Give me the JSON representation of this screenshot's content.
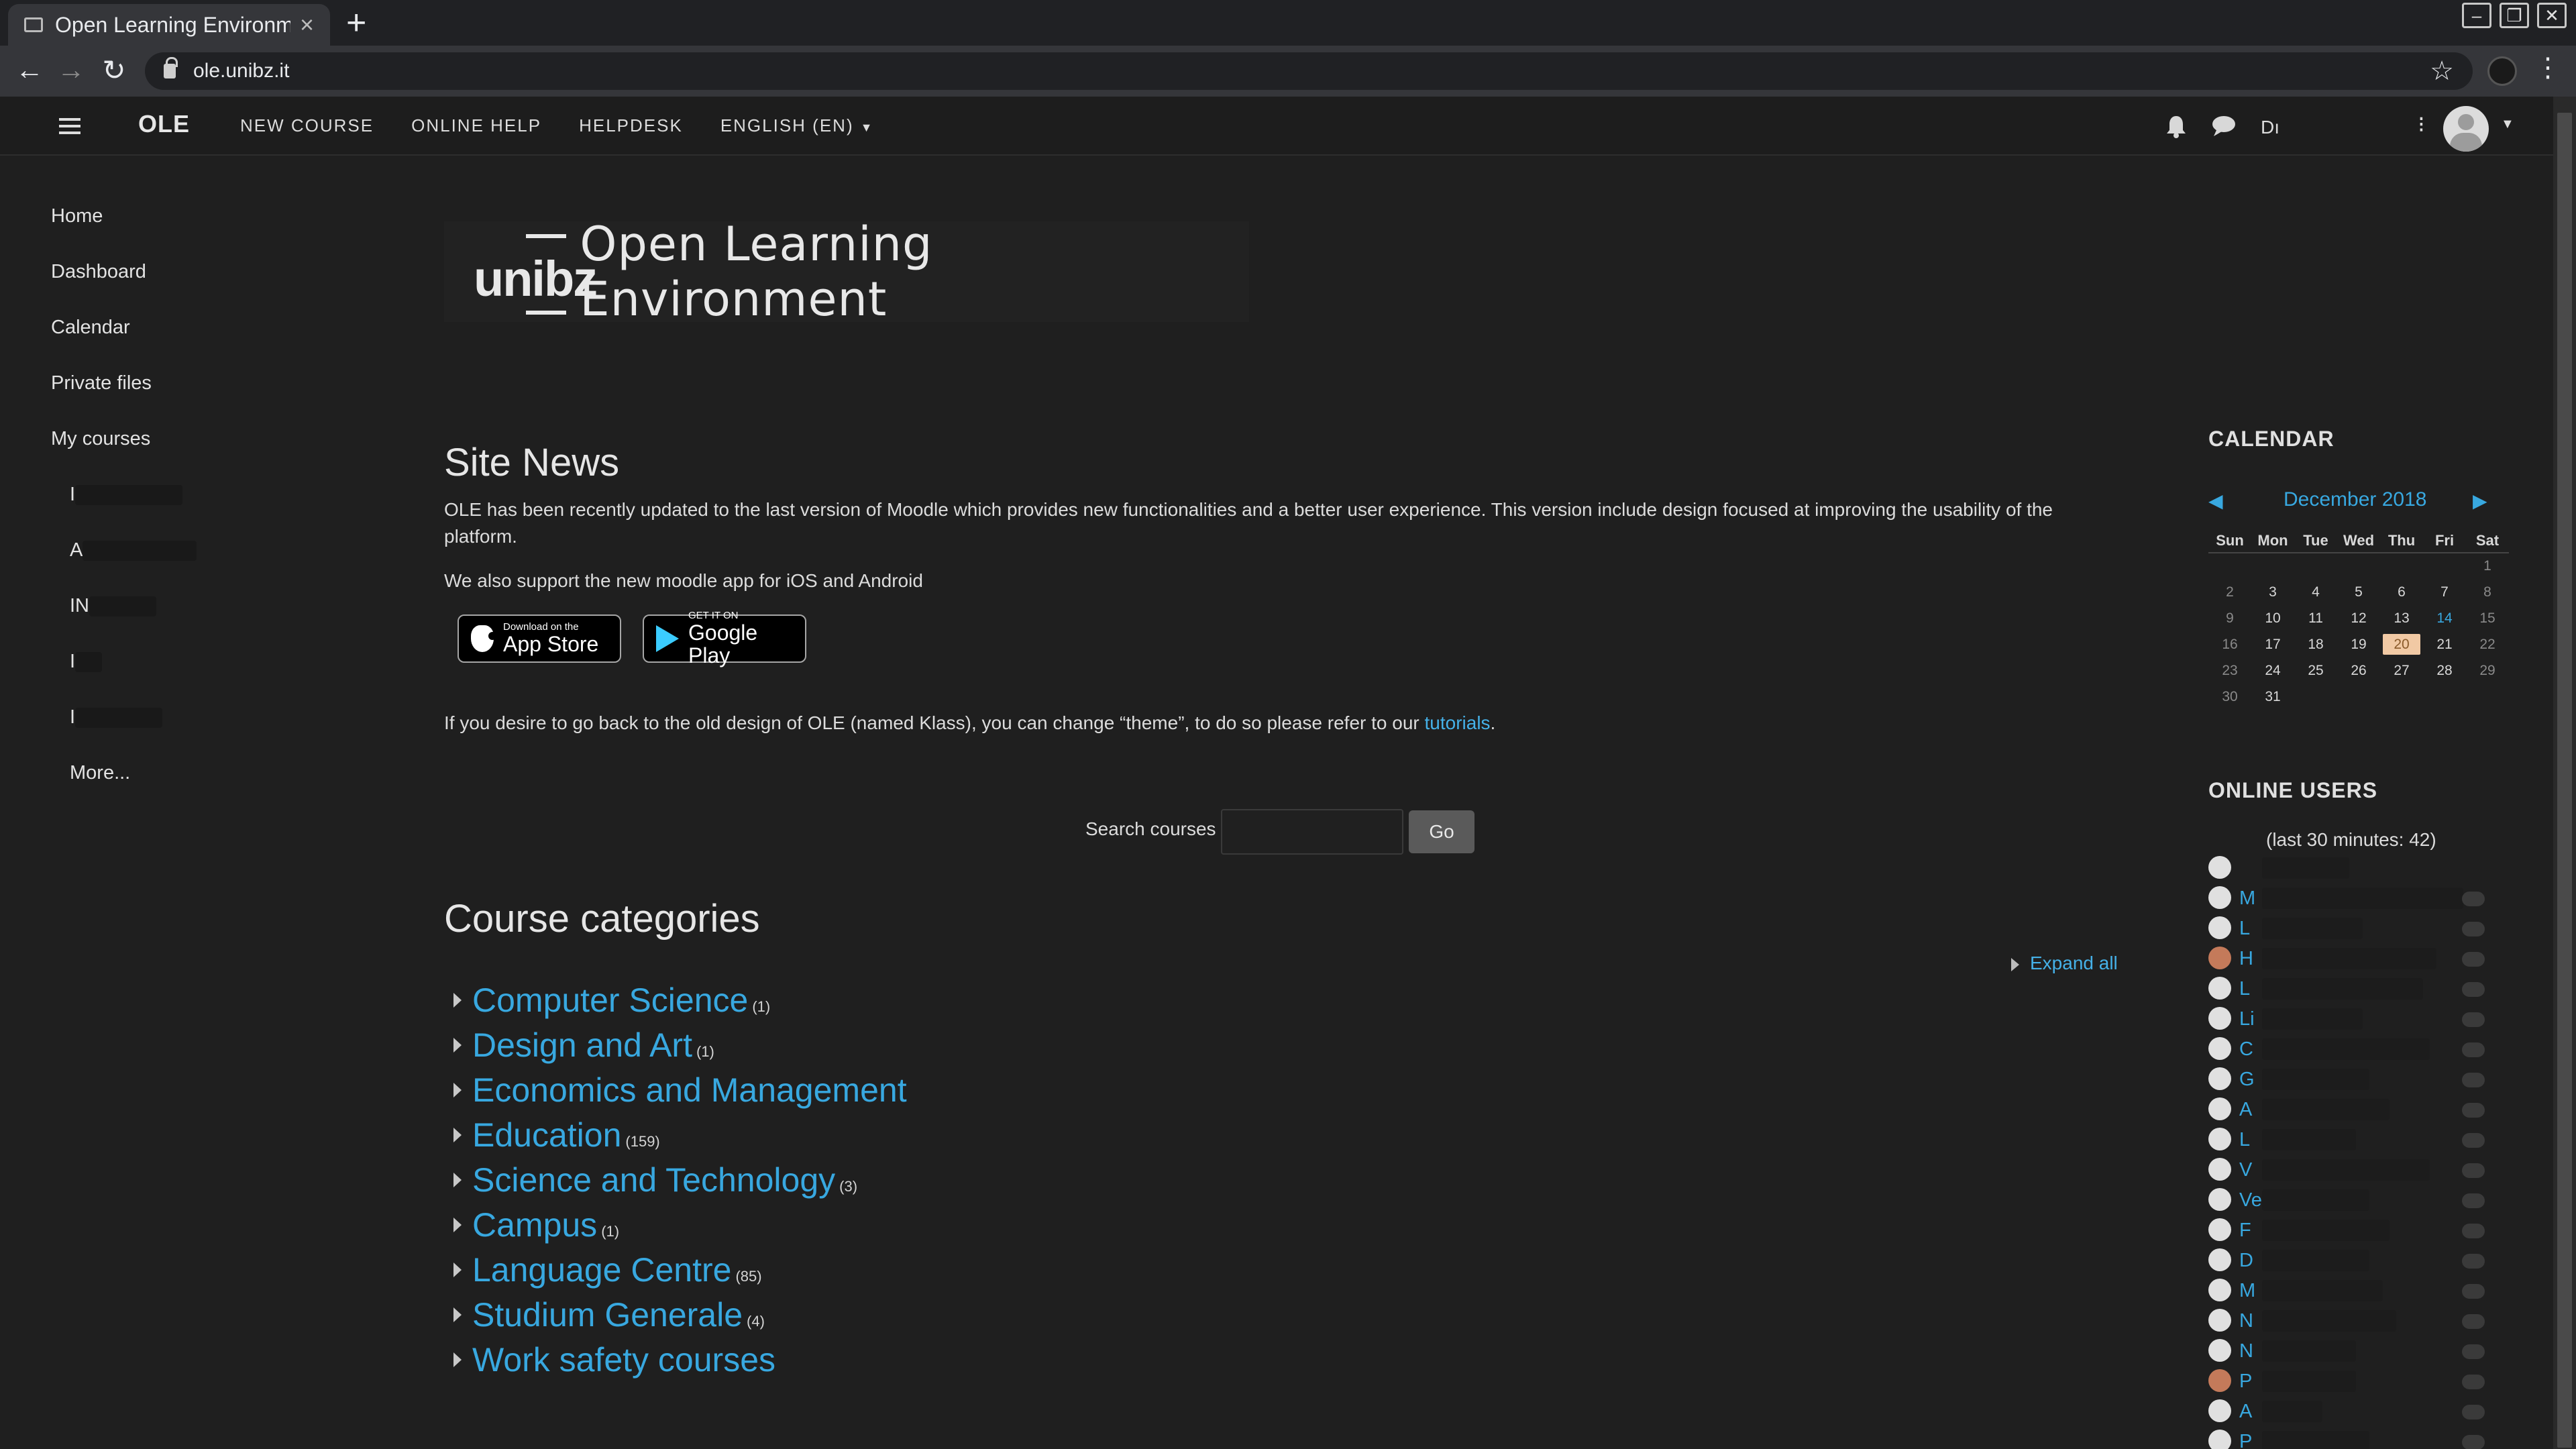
{
  "browser": {
    "tab_title": "Open Learning Environme",
    "url": "ole.unibz.it"
  },
  "navbar": {
    "brand": "OLE",
    "links": [
      "NEW COURSE",
      "ONLINE HELP",
      "HELPDESK",
      "ENGLISH (EN)"
    ],
    "user_initials": "Dı"
  },
  "drawer": {
    "items": [
      "Home",
      "Dashboard",
      "Calendar",
      "Private files",
      "My courses"
    ],
    "courses": [
      "I",
      "A",
      "IN",
      "I",
      "I"
    ],
    "more": "More..."
  },
  "logo": {
    "mark": "unibz",
    "title": "Open Learning Environment"
  },
  "site_news": {
    "heading": "Site News",
    "para1": "OLE has been recently  updated to the last version of Moodle which provides new functionalities and a better user experience. This version include design focused at improving the usability of the platform.",
    "para2": "We also support the new moodle app for iOS and Android",
    "para3_pre": "If you desire to go back to the old design of OLE (named Klass),  you can change “theme”, to do so please refer to our ",
    "para3_link": "tutorials",
    "para3_post": ".",
    "appstore_small": "Download on the",
    "appstore_big": "App Store",
    "googleplay_small": "GET IT ON",
    "googleplay_big": "Google Play"
  },
  "search": {
    "label": "Search courses",
    "button": "Go"
  },
  "categories": {
    "heading": "Course categories",
    "expand_all": "Expand all",
    "items": [
      {
        "name": "Computer Science",
        "count": "(1)"
      },
      {
        "name": "Design and Art",
        "count": "(1)"
      },
      {
        "name": "Economics and Management",
        "count": ""
      },
      {
        "name": "Education",
        "count": "(159)"
      },
      {
        "name": "Science and Technology",
        "count": "(3)"
      },
      {
        "name": "Campus",
        "count": "(1)"
      },
      {
        "name": "Language Centre",
        "count": "(85)"
      },
      {
        "name": "Studium Generale",
        "count": "(4)"
      },
      {
        "name": "Work safety courses",
        "count": ""
      }
    ]
  },
  "calendar": {
    "title": "CALENDAR",
    "month": "December 2018",
    "days": [
      "Sun",
      "Mon",
      "Tue",
      "Wed",
      "Thu",
      "Fri",
      "Sat"
    ],
    "weeks": [
      [
        "",
        "",
        "",
        "",
        "",
        "",
        "1"
      ],
      [
        "2",
        "3",
        "4",
        "5",
        "6",
        "7",
        "8"
      ],
      [
        "9",
        "10",
        "11",
        "12",
        "13",
        "14",
        "15"
      ],
      [
        "16",
        "17",
        "18",
        "19",
        "20",
        "21",
        "22"
      ],
      [
        "23",
        "24",
        "25",
        "26",
        "27",
        "28",
        "29"
      ],
      [
        "30",
        "31",
        "",
        "",
        "",
        "",
        ""
      ]
    ],
    "today": "20",
    "event_days": [
      "14"
    ]
  },
  "online_users": {
    "title": "ONLINE USERS",
    "subtitle": "(last 30 minutes: 42)",
    "users": [
      "",
      "M",
      "L",
      "H",
      "L",
      "Li",
      "C",
      "G",
      "A",
      "L",
      "V",
      "Ve",
      "F",
      "D",
      "M",
      "N",
      "N",
      "P",
      "A",
      "P"
    ]
  }
}
